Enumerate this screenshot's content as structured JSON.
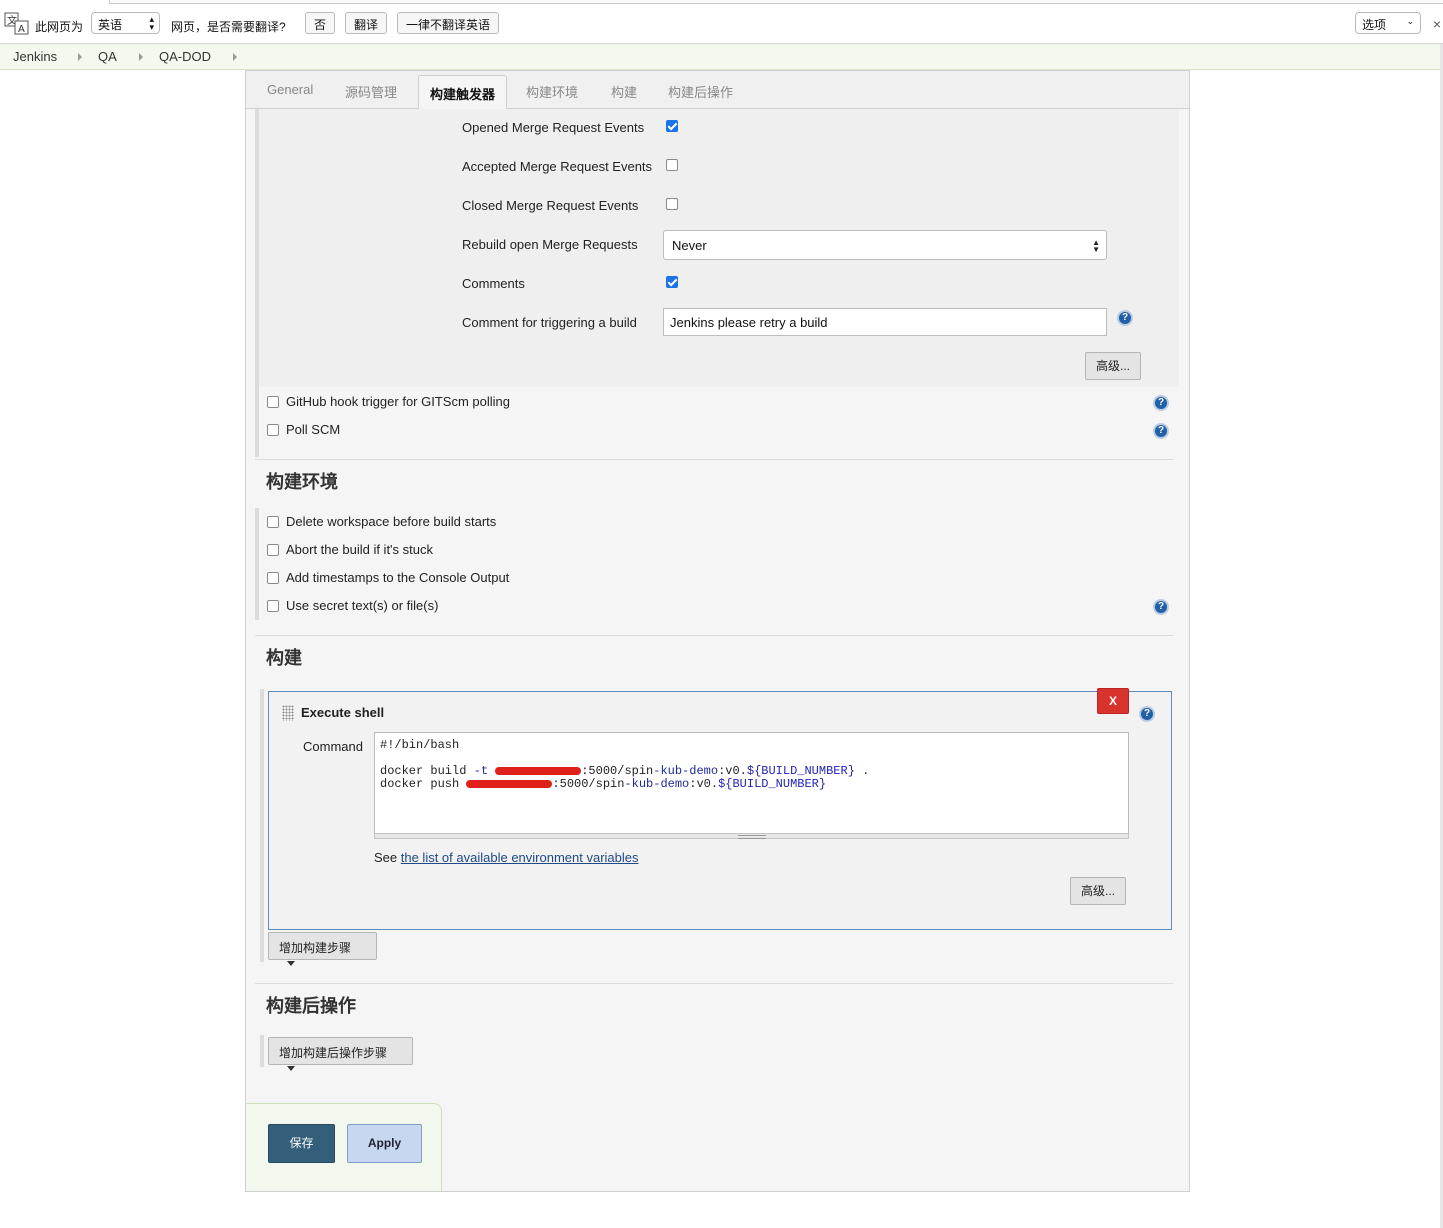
{
  "translate_bar": {
    "prefix": "此网页为",
    "language": "英语",
    "question": "网页，是否需要翻译?",
    "no": "否",
    "translate": "翻译",
    "never": "一律不翻译英语",
    "options": "选项",
    "close": "×"
  },
  "breadcrumb": [
    "Jenkins",
    "QA",
    "QA-DOD"
  ],
  "tabs": [
    "General",
    "源码管理",
    "构建触发器",
    "构建环境",
    "构建",
    "构建后操作"
  ],
  "gitlab_trigger": {
    "opened_mr": "Opened Merge Request Events",
    "accepted_mr": "Accepted Merge Request Events",
    "closed_mr": "Closed Merge Request Events",
    "rebuild_label": "Rebuild open Merge Requests",
    "rebuild_value": "Never",
    "comments": "Comments",
    "comment_trigger_label": "Comment for triggering a build",
    "comment_trigger_value": "Jenkins please retry a build",
    "advanced": "高级..."
  },
  "triggers": {
    "github_hook": "GitHub hook trigger for GITScm polling",
    "poll_scm": "Poll SCM"
  },
  "build_env": {
    "title": "构建环境",
    "delete_ws": "Delete workspace before build starts",
    "abort": "Abort the build if it's stuck",
    "timestamps": "Add timestamps to the Console Output",
    "secret": "Use secret text(s) or file(s)"
  },
  "build": {
    "title": "构建",
    "step_title": "Execute shell",
    "delete": "X",
    "command_label": "Command",
    "line1": "#!/bin/bash",
    "line2_cmd": "docker build ",
    "line2_flag": "-t",
    "line2_rest": ":5000/spin",
    "line2_kub": "-kub-demo",
    "line2_ver": ":v0.",
    "line2_var": "${BUILD_NUMBER}",
    "line2_dot": " .",
    "line3_cmd": "docker push ",
    "see_prefix": "See ",
    "see_link": "the list of available environment variables",
    "advanced": "高级...",
    "add_step": "增加构建步骤"
  },
  "post_build": {
    "title": "构建后操作",
    "add_step": "增加构建后操作步骤"
  },
  "buttons": {
    "save": "保存",
    "apply": "Apply"
  },
  "help": "?"
}
